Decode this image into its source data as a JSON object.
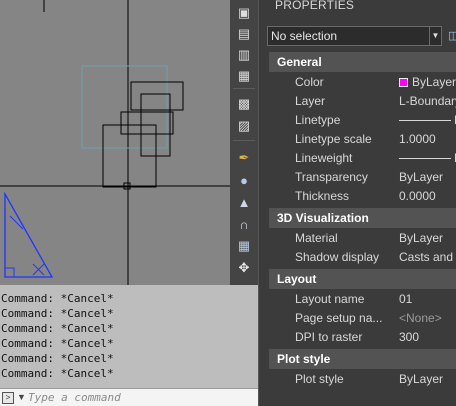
{
  "canvas": {
    "background": "#858585",
    "shape_color": "#000000",
    "triangle_color": "#1f36ff"
  },
  "command": {
    "history": [
      "Command: *Cancel*",
      "Command: *Cancel*",
      "Command: *Cancel*",
      "Command: *Cancel*",
      "Command: *Cancel*",
      "Command: *Cancel*"
    ],
    "placeholder": "Type a command"
  },
  "toolbar": {
    "icons": [
      "layers-icon",
      "layers-stack-icon",
      "layer-states-icon",
      "match-layer-icon",
      "layer-walk-icon",
      "layer-isolate-icon",
      "brush-icon",
      "shapes-icon",
      "mirror-icon",
      "offset-icon",
      "array-icon",
      "move-icon"
    ]
  },
  "properties": {
    "title": "PROPERTIES",
    "selection": "No selection",
    "sections": {
      "general": {
        "title": "General",
        "rows": [
          {
            "label": "Color",
            "value": "ByLayer"
          },
          {
            "label": "Layer",
            "value": "L-Boundary"
          },
          {
            "label": "Linetype",
            "value": "By"
          },
          {
            "label": "Linetype scale",
            "value": "1.0000"
          },
          {
            "label": "Lineweight",
            "value": "By"
          },
          {
            "label": "Transparency",
            "value": "ByLayer"
          },
          {
            "label": "Thickness",
            "value": "0.0000"
          }
        ]
      },
      "visualization": {
        "title": "3D Visualization",
        "rows": [
          {
            "label": "Material",
            "value": "ByLayer"
          },
          {
            "label": "Shadow display",
            "value": "Casts and Re"
          }
        ]
      },
      "layout": {
        "title": "Layout",
        "rows": [
          {
            "label": "Layout name",
            "value": "01"
          },
          {
            "label": "Page setup na...",
            "value": "<None>"
          },
          {
            "label": "DPI to raster",
            "value": "300"
          }
        ]
      },
      "plotstyle": {
        "title": "Plot style",
        "rows": [
          {
            "label": "Plot style",
            "value": "ByLayer"
          }
        ]
      }
    },
    "color_swatch": "#ff00ff"
  }
}
